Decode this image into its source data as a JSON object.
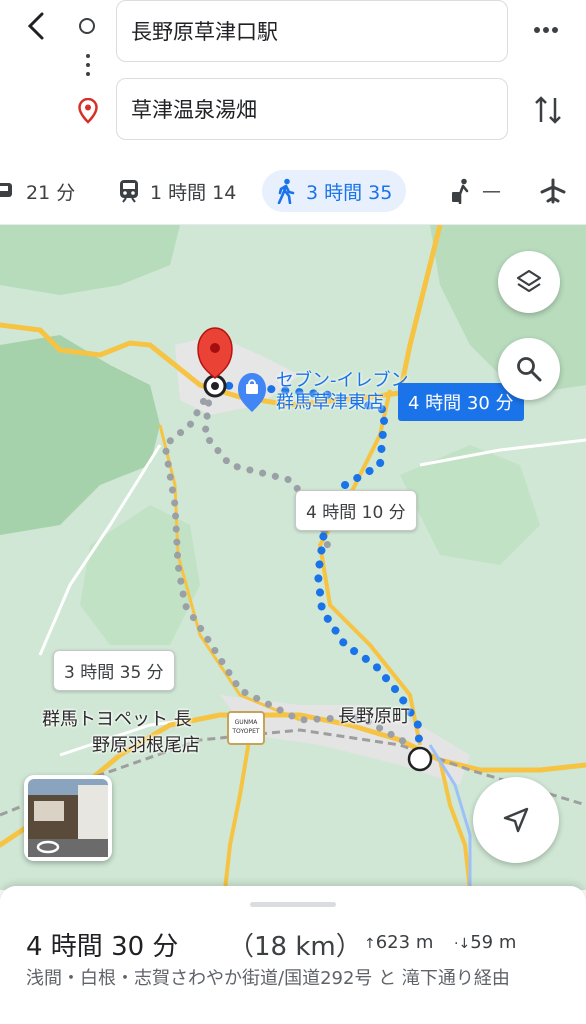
{
  "header": {
    "origin": "長野原草津口駅",
    "destination": "草津温泉湯畑"
  },
  "modes": [
    {
      "icon": "car-icon",
      "label": "21 分"
    },
    {
      "icon": "train-icon",
      "label": "1 時間 14"
    },
    {
      "icon": "walk-icon",
      "label": "3 時間 35",
      "active": true
    },
    {
      "icon": "rideshare-icon",
      "label": "—"
    },
    {
      "icon": "flight-icon",
      "label": "—"
    }
  ],
  "map": {
    "route_labels": {
      "selected": "4 時間 30 分",
      "alt1": "4 時間 10 分",
      "alt2": "3 時間 35 分"
    },
    "poi_lines": [
      "セブン-イレブン",
      "群馬草津東店"
    ],
    "places": {
      "toyopet_line1": "群馬トヨペット 長",
      "toyopet_line2": "野原羽根尾店",
      "toyopet_logo_line1": "GUNMA",
      "toyopet_logo_line2": "TOYOPET",
      "town": "長野原町"
    },
    "colors": {
      "route": "#1a73e8",
      "alt_route": "#9aa0a6",
      "road": "#f6c343",
      "forest": "#a7d3ac"
    }
  },
  "summary": {
    "time": "4 時間 30 分",
    "distance": "（18 km）",
    "ascent": "623 m",
    "descent": "59 m",
    "via": "浅間・白根・志賀さわやか街道/国道292号 と 滝下通り経由"
  }
}
